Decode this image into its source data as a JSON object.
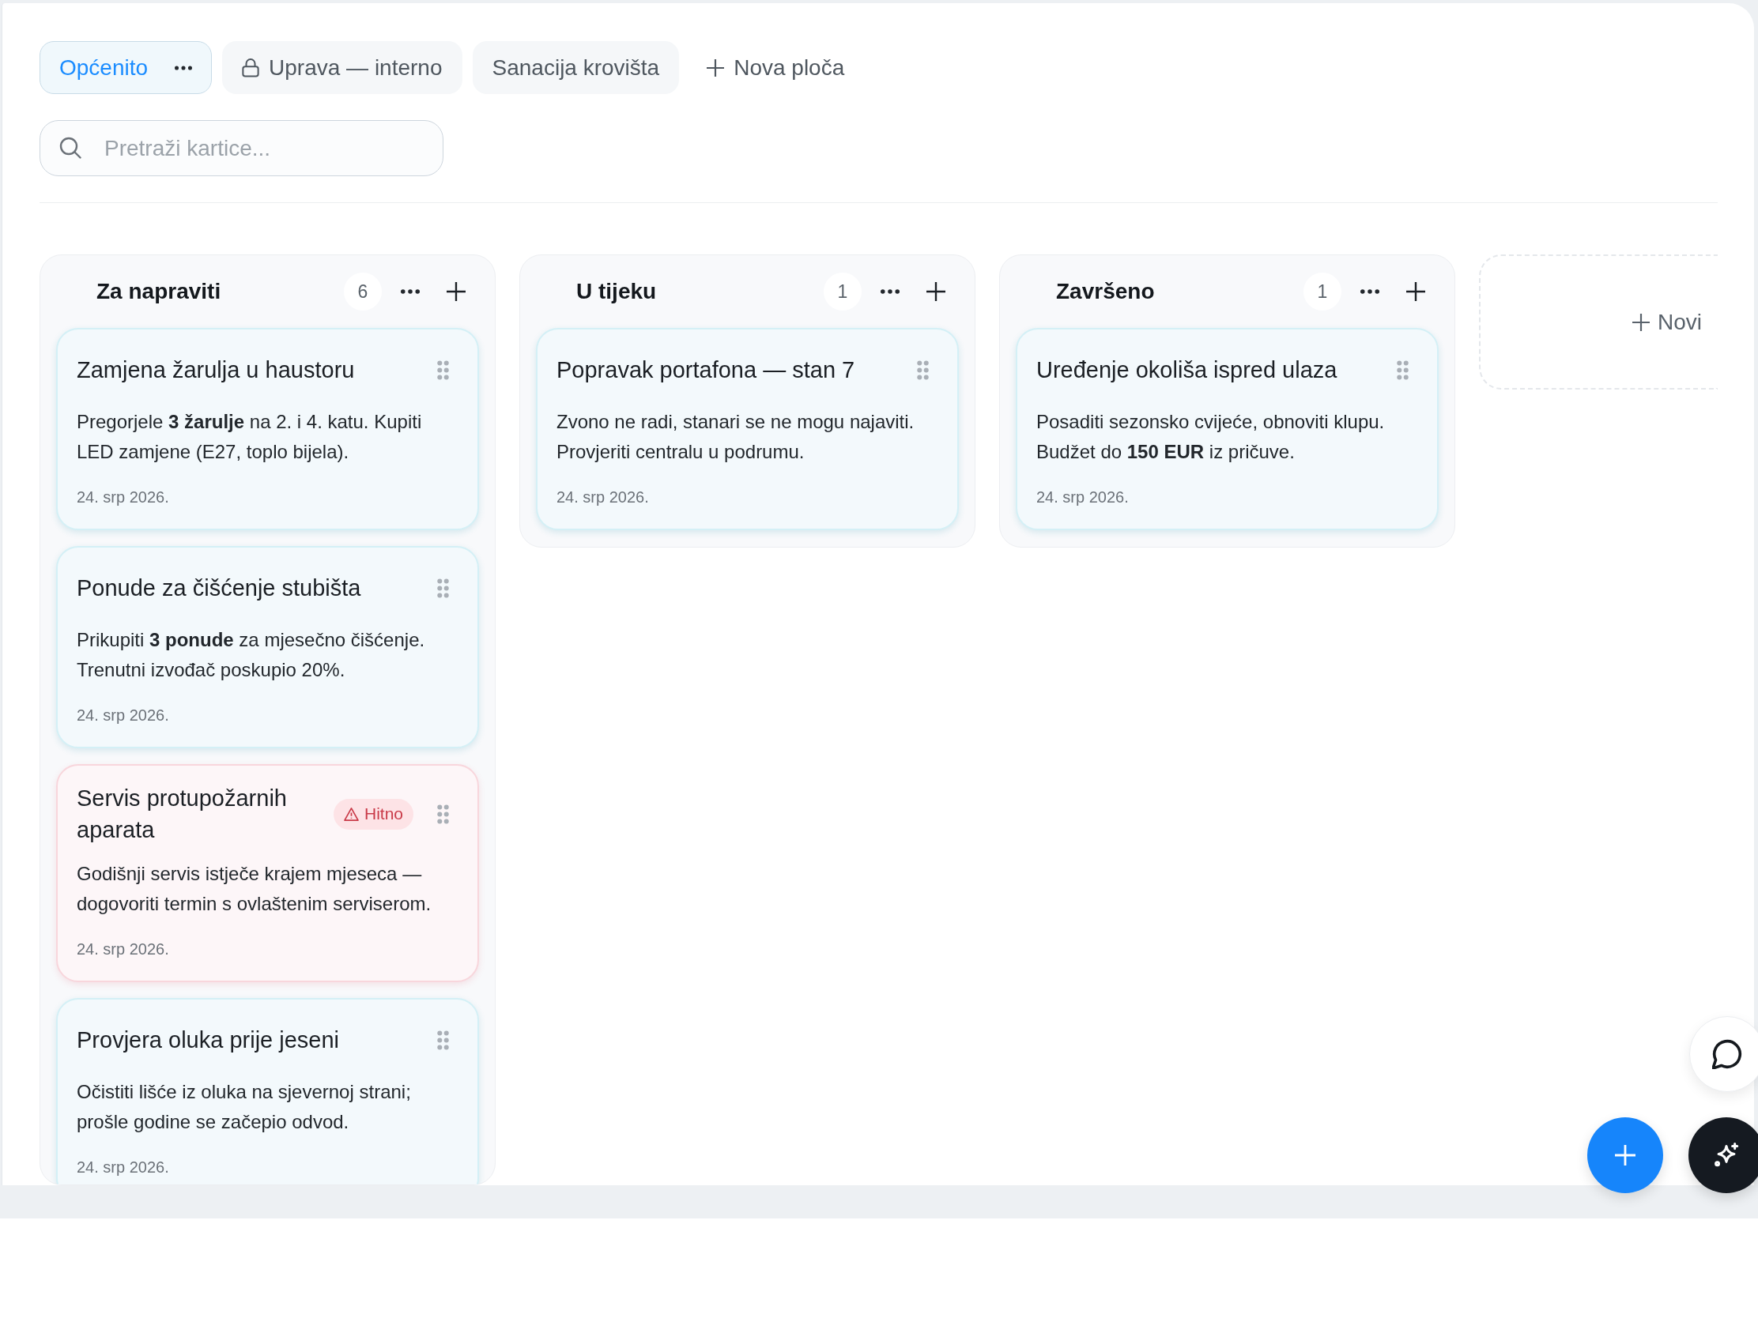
{
  "tabs": [
    {
      "label": "Općenito",
      "selected": true,
      "locked": false
    },
    {
      "label": "Uprava — interno",
      "selected": false,
      "locked": true
    },
    {
      "label": "Sanacija krovišta",
      "selected": false,
      "locked": false
    }
  ],
  "new_board_button": {
    "label": "Nova ploča"
  },
  "search": {
    "placeholder": "Pretraži kartice..."
  },
  "columns": [
    {
      "title": "Za napraviti",
      "count": "6",
      "cards": [
        {
          "title": "Zamjena žarulja u haustoru",
          "body": "Pregorjele **3 žarulje** na 2. i 4. katu. Kupiti LED zamjene (E27, toplo bijela).",
          "date": "24. srp 2026.",
          "urgent": false
        },
        {
          "title": "Ponude za čišćenje stubišta",
          "body": "Prikupiti **3 ponude** za mjesečno čišćenje. Trenutni izvođač poskupio 20%.",
          "date": "24. srp 2026.",
          "urgent": false
        },
        {
          "title": "Servis protupožarnih aparata",
          "badge": "Hitno",
          "body": "Godišnji servis istječe krajem mjeseca — dogovoriti termin s ovlaštenim serviserom.",
          "date": "24. srp 2026.",
          "urgent": true
        },
        {
          "title": "Provjera oluka prije jeseni",
          "body": "Očistiti lišće iz oluka na sjevernoj strani; prošle godine se začepio odvod.",
          "date": "24. srp 2026.",
          "urgent": false
        }
      ]
    },
    {
      "title": "U tijeku",
      "count": "1",
      "cards": [
        {
          "title": "Popravak portafona — stan 7",
          "body": "Zvono ne radi, stanari se ne mogu najaviti. Provjeriti centralu u podrumu.",
          "date": "24. srp 2026.",
          "urgent": false
        }
      ]
    },
    {
      "title": "Završeno",
      "count": "1",
      "cards": [
        {
          "title": "Uređenje okoliša ispred ulaza",
          "body": "Posaditi sezonsko cvijeće, obnoviti klupu. Budžet do **150 EUR** iz pričuve.",
          "date": "24. srp 2026.",
          "urgent": false
        }
      ]
    }
  ],
  "add_column": {
    "label": "Novi"
  }
}
